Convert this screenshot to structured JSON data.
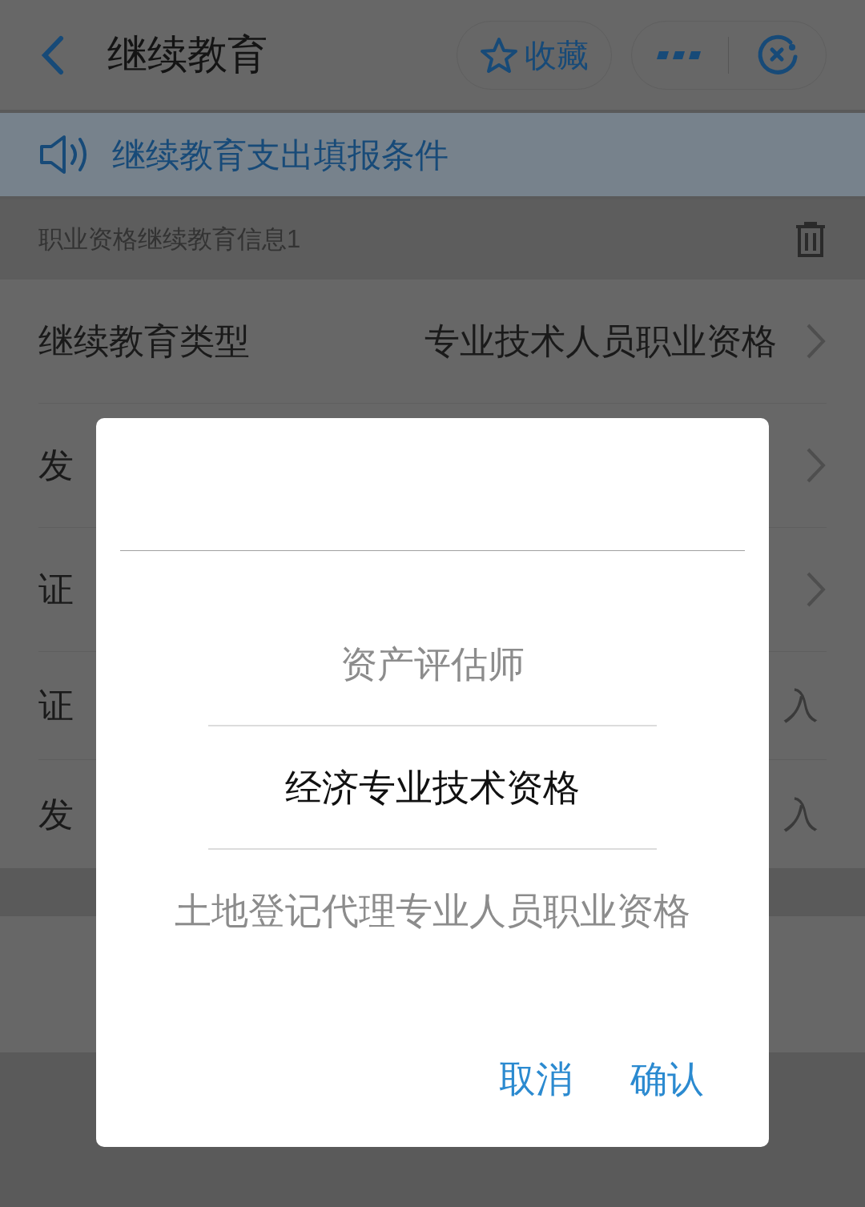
{
  "header": {
    "title": "继续教育",
    "favorite_label": "收藏"
  },
  "notice": {
    "text": "继续教育支出填报条件"
  },
  "section": {
    "title": "职业资格继续教育信息1"
  },
  "rows": [
    {
      "label": "继续教育类型",
      "value": "专业技术人员职业资格",
      "kind": "select"
    },
    {
      "label": "发",
      "kind": "select"
    },
    {
      "label": "证",
      "kind": "select"
    },
    {
      "label": "证",
      "value": "入",
      "kind": "input"
    },
    {
      "label": "发",
      "value": "入",
      "kind": "input"
    }
  ],
  "picker": {
    "options": [
      {
        "label": "资产评估师",
        "selected": false
      },
      {
        "label": "经济专业技术资格",
        "selected": true
      },
      {
        "label": "土地登记代理专业人员职业资格",
        "selected": false
      }
    ],
    "buttons": [
      "取消",
      "确认"
    ]
  }
}
